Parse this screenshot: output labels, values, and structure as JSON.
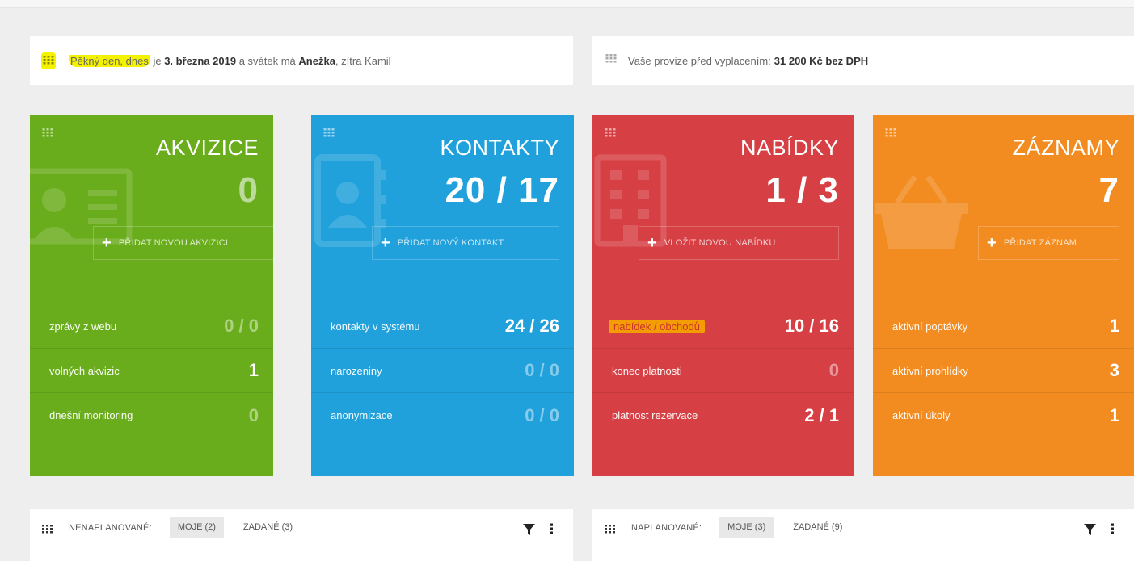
{
  "greeting": {
    "part1": "Pěkný den, dnes",
    "part2": " je ",
    "date": "3. března 2019",
    "part3": " a svátek má ",
    "name": "Anežka",
    "part4": ", zítra Kamil"
  },
  "provize": {
    "label": "Vaše provize před vyplacením: ",
    "value": "31 200 Kč bez DPH"
  },
  "cards": [
    {
      "title": "AKVIZICE",
      "big": "0",
      "add": "PŘIDAT NOVOU AKVIZICI",
      "icon": "id-card-icon",
      "rows": [
        {
          "label": "zprávy z webu",
          "value": "0 / 0"
        },
        {
          "label": "volných akvizic",
          "value": "1"
        },
        {
          "label": "dnešní monitoring",
          "value": "0"
        }
      ]
    },
    {
      "title": "KONTAKTY",
      "big": "20 / 17",
      "add": "PŘIDAT NOVÝ KONTAKT",
      "icon": "address-book-icon",
      "rows": [
        {
          "label": "kontakty v systému",
          "value": "24 / 26"
        },
        {
          "label": "narozeniny",
          "value": "0 / 0"
        },
        {
          "label": "anonymizace",
          "value": "0 / 0"
        }
      ]
    },
    {
      "title": "NABÍDKY",
      "big": "1 / 3",
      "add": "VLOŽIT NOVOU NABÍDKU",
      "icon": "building-icon",
      "rows": [
        {
          "label": "nabídek / obchodů",
          "value": "10 / 16"
        },
        {
          "label": "konec platnosti",
          "value": "0"
        },
        {
          "label": "platnost rezervace",
          "value": "2 / 1"
        }
      ]
    },
    {
      "title": "ZÁZNAMY",
      "big": "7",
      "add": "PŘIDAT ZÁZNAM",
      "icon": "basket-icon",
      "rows": [
        {
          "label": "aktivní poptávky",
          "value": "1"
        },
        {
          "label": "aktivní prohlídky",
          "value": "3"
        },
        {
          "label": "aktivní úkoly",
          "value": "1"
        }
      ]
    }
  ],
  "colors": {
    "green": "#6aad1c",
    "blue": "#21a1db",
    "red": "#d64045",
    "orange": "#f28c21",
    "highlight_yellow": "#f4f200",
    "highlight_orange": "#f5a300"
  },
  "panels": [
    {
      "label": "NENAPLANOVANÉ:",
      "tab_mine": "MOJE (2)",
      "tab_assigned": "ZADANÉ (3)"
    },
    {
      "label": "NAPLANOVANÉ:",
      "tab_mine": "MOJE (3)",
      "tab_assigned": "ZADANÉ (9)"
    }
  ]
}
